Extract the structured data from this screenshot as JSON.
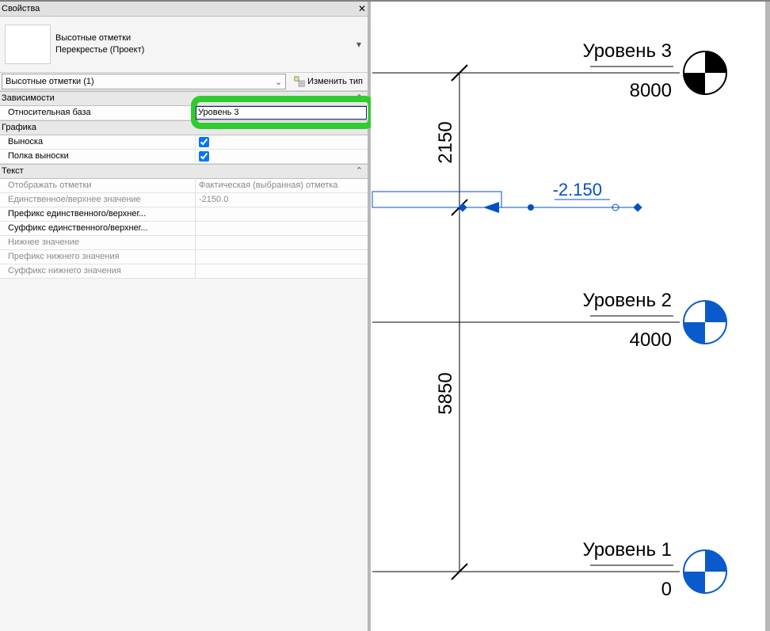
{
  "panel": {
    "title": "Свойства",
    "type_line1": "Высотные отметки",
    "type_line2": "Перекрестье (Проект)",
    "filter_label": "Высотные отметки (1)",
    "edit_type_label": "Изменить тип"
  },
  "props": {
    "cat_constraints": "Зависимости",
    "relative_base_label": "Относительная база",
    "relative_base_value": "Уровень 3",
    "cat_graphics": "Графика",
    "leader_label": "Выноска",
    "leader_checked": true,
    "shoulder_label": "Полка выноски",
    "shoulder_checked": true,
    "cat_text": "Текст",
    "display_elev_label": "Отображать отметки",
    "display_elev_value": "Фактическая (выбранная) отметка",
    "single_upper_label": "Единственное/верхнее значение",
    "single_upper_value": "-2150.0",
    "prefix_upper_label": "Префикс единственного/верхнег...",
    "prefix_upper_value": "",
    "suffix_upper_label": "Суффикс единственного/верхнег...",
    "suffix_upper_value": "",
    "lower_value_label": "Нижнее значение",
    "lower_value_value": "",
    "prefix_lower_label": "Префикс нижнего значения",
    "prefix_lower_value": "",
    "suffix_lower_label": "Суффикс нижнего значения",
    "suffix_lower_value": ""
  },
  "drawing": {
    "levels": [
      {
        "name": "Уровень 3",
        "value": "8000"
      },
      {
        "name": "Уровень 2",
        "value": "4000"
      },
      {
        "name": "Уровень 1",
        "value": "0"
      }
    ],
    "dim_top": "2150",
    "dim_bottom": "5850",
    "spot_value": "-2.150",
    "colors": {
      "level_line": "#000000",
      "spot": "#0050c8",
      "marker_fill_level3": "#000000",
      "marker_fill_other": "#0a5acb"
    }
  }
}
